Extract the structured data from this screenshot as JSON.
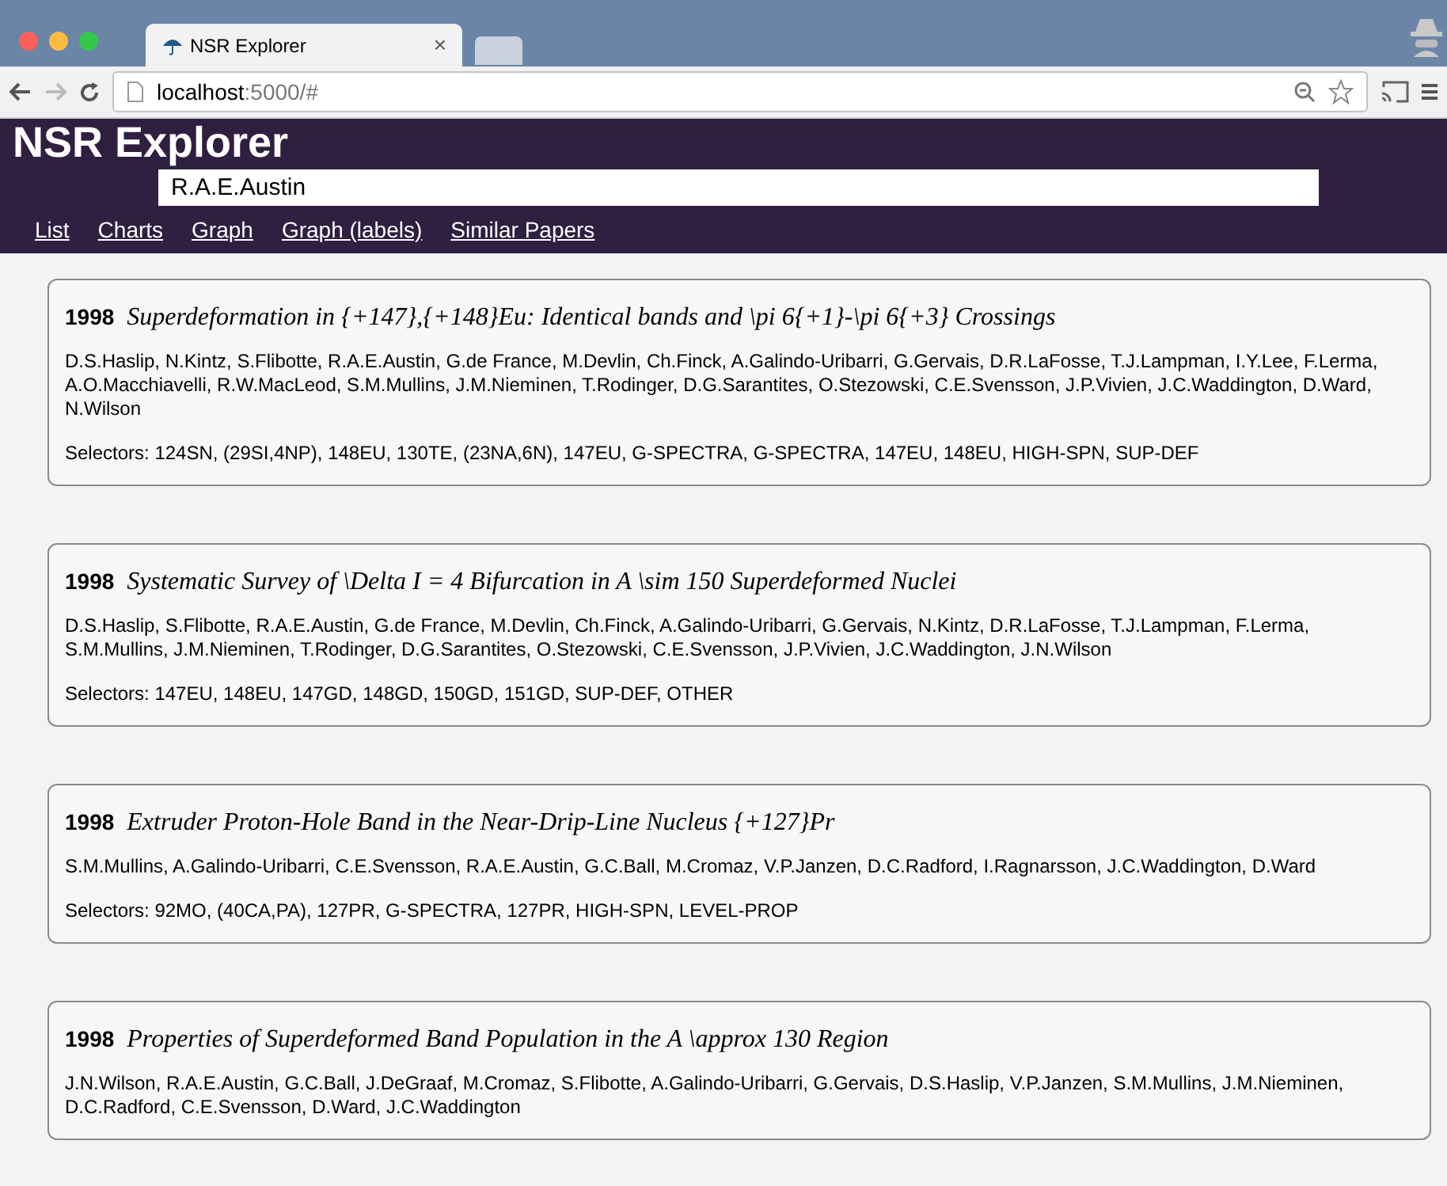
{
  "browser": {
    "tab_title": "NSR Explorer",
    "tab_close": "×",
    "url_host": "localhost",
    "url_rest": ":5000/#"
  },
  "app": {
    "title": "NSR Explorer",
    "search": {
      "value": "R.A.E.Austin"
    },
    "nav": [
      {
        "label": "List"
      },
      {
        "label": "Charts"
      },
      {
        "label": "Graph"
      },
      {
        "label": "Graph (labels)"
      },
      {
        "label": "Similar Papers"
      }
    ]
  },
  "papers": [
    {
      "year": "1998",
      "title": "Superdeformation in {+147},{+148}Eu: Identical bands and \\pi 6{+1}-\\pi 6{+3} Crossings",
      "authors": "D.S.Haslip, N.Kintz, S.Flibotte, R.A.E.Austin, G.de France, M.Devlin, Ch.Finck, A.Galindo-Uribarri, G.Gervais, D.R.LaFosse, T.J.Lampman, I.Y.Lee, F.Lerma, A.O.Macchiavelli, R.W.MacLeod, S.M.Mullins, J.M.Nieminen, T.Rodinger, D.G.Sarantites, O.Stezowski, C.E.Svensson, J.P.Vivien, J.C.Waddington, D.Ward, N.Wilson",
      "selectors": "Selectors: 124SN, (29SI,4NP), 148EU, 130TE, (23NA,6N), 147EU, G-SPECTRA, G-SPECTRA, 147EU, 148EU, HIGH-SPN, SUP-DEF"
    },
    {
      "year": "1998",
      "title": "Systematic Survey of \\Delta I = 4 Bifurcation in A \\sim 150 Superdeformed Nuclei",
      "authors": "D.S.Haslip, S.Flibotte, R.A.E.Austin, G.de France, M.Devlin, Ch.Finck, A.Galindo-Uribarri, G.Gervais, N.Kintz, D.R.LaFosse, T.J.Lampman, F.Lerma, S.M.Mullins, J.M.Nieminen, T.Rodinger, D.G.Sarantites, O.Stezowski, C.E.Svensson, J.P.Vivien, J.C.Waddington, J.N.Wilson",
      "selectors": "Selectors: 147EU, 148EU, 147GD, 148GD, 150GD, 151GD, SUP-DEF, OTHER"
    },
    {
      "year": "1998",
      "title": "Extruder Proton-Hole Band in the Near-Drip-Line Nucleus {+127}Pr",
      "authors": "S.M.Mullins, A.Galindo-Uribarri, C.E.Svensson, R.A.E.Austin, G.C.Ball, M.Cromaz, V.P.Janzen, D.C.Radford, I.Ragnarsson, J.C.Waddington, D.Ward",
      "selectors": "Selectors: 92MO, (40CA,PA), 127PR, G-SPECTRA, 127PR, HIGH-SPN, LEVEL-PROP"
    },
    {
      "year": "1998",
      "title": "Properties of Superdeformed Band Population in the A \\approx 130 Region",
      "authors": "J.N.Wilson, R.A.E.Austin, G.C.Ball, J.DeGraaf, M.Cromaz, S.Flibotte, A.Galindo-Uribarri, G.Gervais, D.S.Haslip, V.P.Janzen, S.M.Mullins, J.M.Nieminen, D.C.Radford, C.E.Svensson, D.Ward, J.C.Waddington"
    }
  ]
}
